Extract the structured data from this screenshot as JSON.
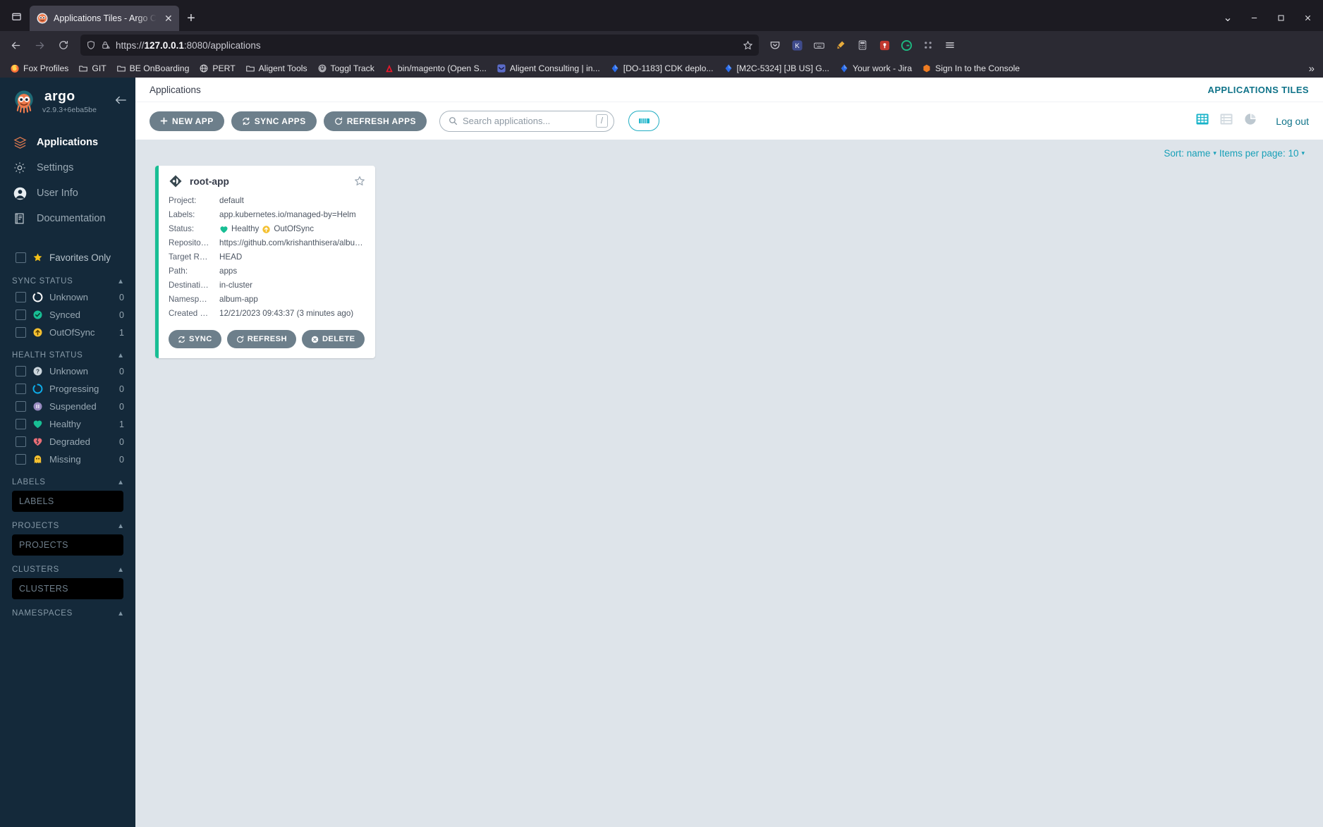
{
  "browser": {
    "tab": {
      "title": "Applications Tiles - Argo C",
      "close_label": "✕"
    },
    "new_tab_label": "+",
    "url": {
      "scheme": "https://",
      "host": "127.0.0.1",
      "path": ":8080/applications"
    },
    "window_controls": {
      "minimize": "—",
      "maximize": "❐",
      "close": "✕",
      "chevron": "⌄"
    },
    "bookmarks": [
      {
        "label": "Fox Profiles",
        "icon": "firefox-icon"
      },
      {
        "label": "GIT",
        "icon": "folder-icon"
      },
      {
        "label": "BE OnBoarding",
        "icon": "folder-icon"
      },
      {
        "label": "PERT",
        "icon": "globe-icon"
      },
      {
        "label": "Aligent Tools",
        "icon": "folder-icon"
      },
      {
        "label": "Toggl Track",
        "icon": "toggl-icon"
      },
      {
        "label": "bin/magento (Open S...",
        "icon": "adobe-icon"
      },
      {
        "label": "Aligent Consulting | in...",
        "icon": "aligent-icon"
      },
      {
        "label": "[DO-1183] CDK deplo...",
        "icon": "jira-icon"
      },
      {
        "label": "[M2C-5324] [JB US] G...",
        "icon": "jira-icon"
      },
      {
        "label": "Your work - Jira",
        "icon": "jira-icon"
      },
      {
        "label": "Sign In to the Console",
        "icon": "aws-icon"
      }
    ],
    "bookmarks_overflow": "»"
  },
  "sidebar": {
    "brand": "argo",
    "version": "v2.9.3+6eba5be",
    "collapse_icon": "arrow-left-icon",
    "nav": [
      {
        "label": "Applications",
        "icon": "layers-icon",
        "active": true
      },
      {
        "label": "Settings",
        "icon": "gear-icon",
        "active": false
      },
      {
        "label": "User Info",
        "icon": "user-circle-icon",
        "active": false
      },
      {
        "label": "Documentation",
        "icon": "book-icon",
        "active": false
      }
    ],
    "favorites_only": {
      "label": "Favorites Only",
      "icon": "star-icon",
      "checked": false
    },
    "sync_status": {
      "title": "SYNC STATUS",
      "items": [
        {
          "label": "Unknown",
          "count": "0",
          "icon": "circle-notch-icon",
          "color": "#ffffff"
        },
        {
          "label": "Synced",
          "count": "0",
          "icon": "check-circle-icon",
          "color": "#18be94"
        },
        {
          "label": "OutOfSync",
          "count": "1",
          "icon": "arrow-up-circle-icon",
          "color": "#f4c030"
        }
      ]
    },
    "health_status": {
      "title": "HEALTH STATUS",
      "items": [
        {
          "label": "Unknown",
          "count": "0",
          "icon": "question-circle-icon",
          "color": "#ccd6dd"
        },
        {
          "label": "Progressing",
          "count": "0",
          "icon": "circle-notch-icon",
          "color": "#0dadea"
        },
        {
          "label": "Suspended",
          "count": "0",
          "icon": "pause-circle-icon",
          "color": "#988bc0"
        },
        {
          "label": "Healthy",
          "count": "1",
          "icon": "heart-icon",
          "color": "#18be94"
        },
        {
          "label": "Degraded",
          "count": "0",
          "icon": "heart-broken-icon",
          "color": "#e96d76"
        },
        {
          "label": "Missing",
          "count": "0",
          "icon": "ghost-icon",
          "color": "#f4c030"
        }
      ]
    },
    "labels": {
      "title": "LABELS",
      "placeholder": "LABELS"
    },
    "projects": {
      "title": "PROJECTS",
      "placeholder": "PROJECTS"
    },
    "clusters": {
      "title": "CLUSTERS",
      "placeholder": "CLUSTERS"
    },
    "namespaces": {
      "title": "NAMESPACES"
    },
    "caret": "▲"
  },
  "header": {
    "breadcrumb": "Applications",
    "right_title": "APPLICATIONS TILES"
  },
  "toolbar": {
    "new_app": "NEW APP",
    "sync_apps": "SYNC APPS",
    "refresh_apps": "REFRESH APPS",
    "search_placeholder": "Search applications...",
    "search_value": "",
    "search_shortcut": "/",
    "filter_icon": "sliders-icon",
    "views": [
      {
        "name": "tiles-view",
        "icon": "grid-icon",
        "active": true
      },
      {
        "name": "list-view",
        "icon": "list-icon",
        "active": false
      },
      {
        "name": "summary-view",
        "icon": "pie-chart-icon",
        "active": false
      }
    ],
    "logout": "Log out",
    "accent": "#18a0b8"
  },
  "content": {
    "sort_label": "Sort: name",
    "items_per_page_label": "Items per page: 10",
    "caret": "▾",
    "apps": [
      {
        "name": "root-app",
        "kind_icon": "application-icon",
        "favorite_icon": "star-outline-icon",
        "rows": [
          {
            "key": "Project:",
            "value": "default"
          },
          {
            "key": "Labels:",
            "value": "app.kubernetes.io/managed-by=Helm"
          },
          {
            "key": "Repository:",
            "key_display": "Reposito…",
            "value": "https://github.com/krishanthisera/album-…"
          },
          {
            "key": "Target Revision:",
            "key_display": "Target R…",
            "value": "HEAD"
          },
          {
            "key": "Path:",
            "key_display": "Path:",
            "value": "apps"
          },
          {
            "key": "Destination:",
            "key_display": "Destinati…",
            "value": "in-cluster"
          },
          {
            "key": "Namespace:",
            "key_display": "Namesp…",
            "value": "album-app"
          },
          {
            "key": "Created At:",
            "key_display": "Created …",
            "value": "12/21/2023 09:43:37  (3 minutes ago)"
          }
        ],
        "status": {
          "key": "Status:",
          "health": "Healthy",
          "health_color": "#18be94",
          "sync": "OutOfSync",
          "sync_color": "#f4c030"
        },
        "actions": [
          {
            "label": "SYNC",
            "icon": "sync-icon"
          },
          {
            "label": "REFRESH",
            "icon": "refresh-icon"
          },
          {
            "label": "DELETE",
            "icon": "delete-icon"
          }
        ],
        "health_bar_color": "#18be94"
      }
    ]
  }
}
